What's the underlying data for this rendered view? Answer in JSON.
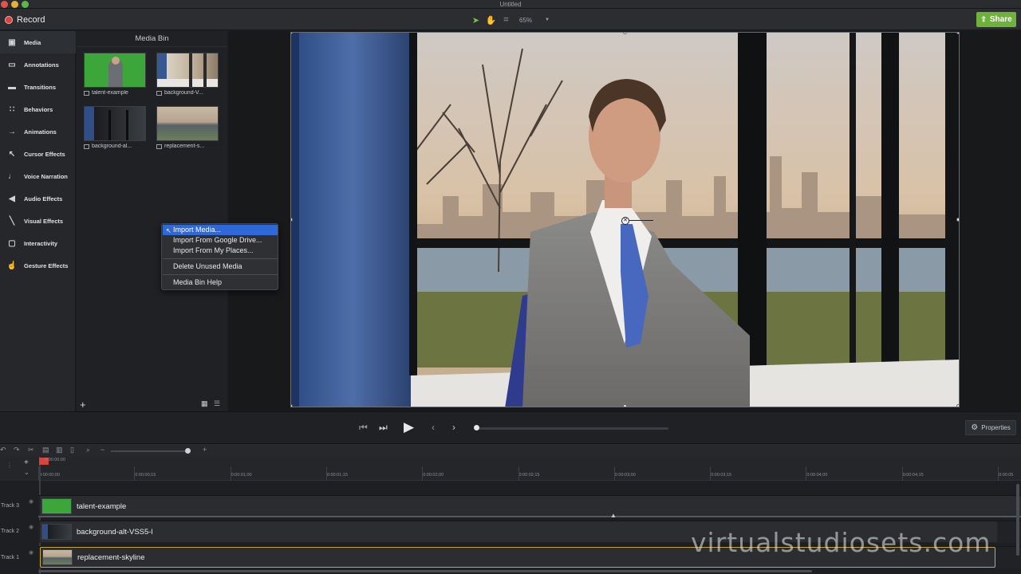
{
  "window": {
    "title": "Untitled"
  },
  "toolbar": {
    "record_label": "Record",
    "zoom_level": "65%",
    "share_label": "Share"
  },
  "sidebar": {
    "items": [
      {
        "label": "Media",
        "icon": "media-icon"
      },
      {
        "label": "Annotations",
        "icon": "annotations-icon"
      },
      {
        "label": "Transitions",
        "icon": "transitions-icon"
      },
      {
        "label": "Behaviors",
        "icon": "behaviors-icon"
      },
      {
        "label": "Animations",
        "icon": "animations-icon"
      },
      {
        "label": "Cursor Effects",
        "icon": "cursor-icon"
      },
      {
        "label": "Voice Narration",
        "icon": "microphone-icon"
      },
      {
        "label": "Audio Effects",
        "icon": "speaker-icon"
      },
      {
        "label": "Visual Effects",
        "icon": "wand-icon"
      },
      {
        "label": "Interactivity",
        "icon": "interactivity-icon"
      },
      {
        "label": "Gesture Effects",
        "icon": "hand-icon"
      }
    ]
  },
  "media_bin": {
    "title": "Media Bin",
    "items": [
      {
        "label": "talent-example"
      },
      {
        "label": "background-V..."
      },
      {
        "label": "background-al..."
      },
      {
        "label": "replacement-s..."
      }
    ]
  },
  "context_menu": {
    "items": [
      "Import Media...",
      "Import From Google Drive...",
      "Import From My Places...",
      "Delete Unused Media",
      "Media Bin Help"
    ]
  },
  "playback": {
    "properties_label": "Properties"
  },
  "timeline": {
    "playhead_time": "0:00:00;00",
    "ticks": [
      "0:00:00;00",
      "0:00:00;15",
      "0:00:01;00",
      "0:00:01;15",
      "0:00:02;00",
      "0:00:02;15",
      "0:00:03;00",
      "0:00:03;15",
      "0:00:04;00",
      "0:00:04;15",
      "0:00:05"
    ],
    "tracks": [
      {
        "name": "Track 3",
        "clip": "talent-example"
      },
      {
        "name": "Track 2",
        "clip": "background-alt-VSS5-l"
      },
      {
        "name": "Track 1",
        "clip": "replacement-skyline"
      }
    ]
  },
  "watermark": "virtualstudiosets.com",
  "colors": {
    "accent": "#6fb23a",
    "record": "#d8433d",
    "menu_highlight": "#2f69d9",
    "selected_clip_border": "#c9a83c"
  }
}
